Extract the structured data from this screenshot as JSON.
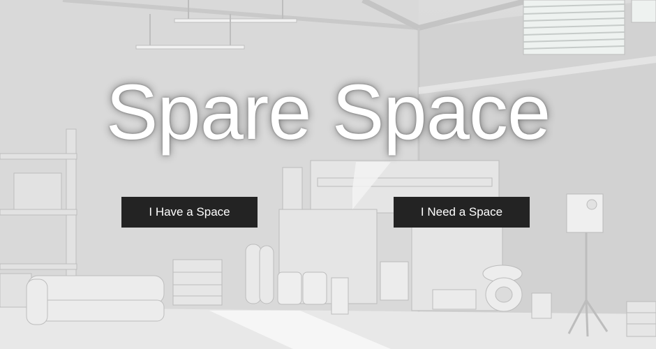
{
  "hero": {
    "title": "Spare Space",
    "buttons": {
      "have_label": "I Have a Space",
      "need_label": "I Need a Space"
    }
  },
  "colors": {
    "button_bg": "#232323",
    "button_text": "#ffffff",
    "title_text": "#ffffff",
    "background": "#d6d6d6"
  }
}
